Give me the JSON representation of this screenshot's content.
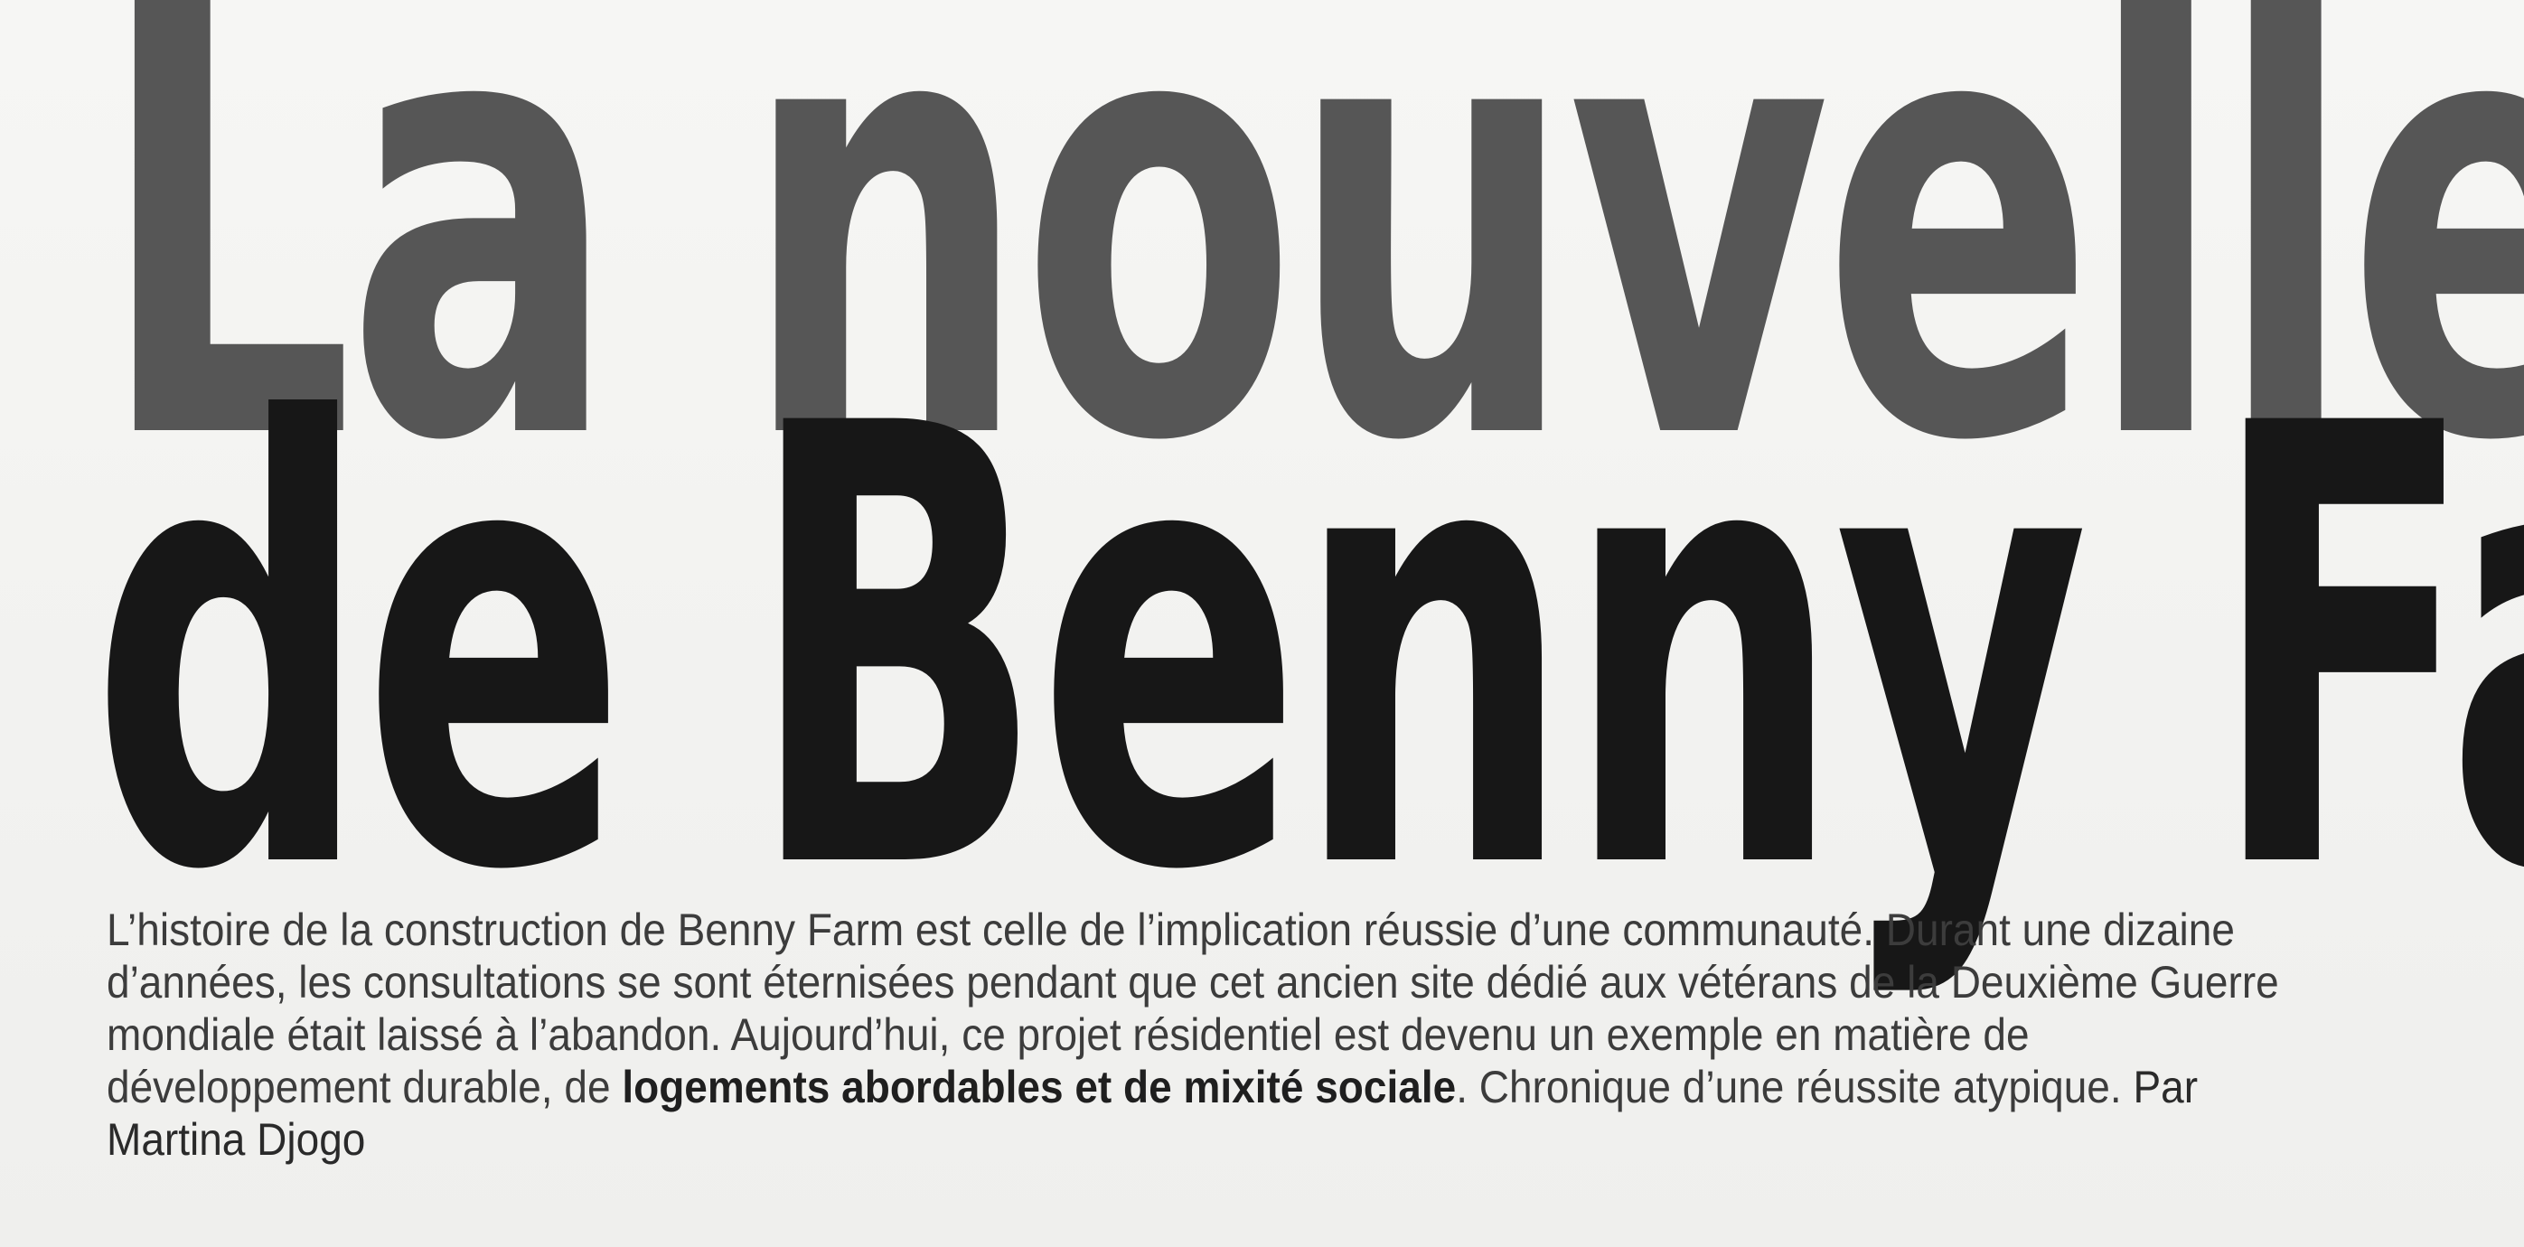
{
  "headline": {
    "line1": "La nouvelle vie",
    "line2": "de Benny Farm"
  },
  "intro": {
    "part1": "L’histoire de la construction de Benny Farm est celle de l’implication réussie d’une communauté. Durant une dizaine d’années, les consultations se sont éternisées pendant que cet ancien site dédié aux vétérans de la Deuxième Guerre mondiale était laissé à l’abandon. Aujourd’hui, ce projet résidentiel est devenu un exemple en matière de développement durable, de ",
    "emphasis": "logements abordables et de mixité sociale",
    "part2": ". Chronique d’une réussite atypique.",
    "byline": "Par Martina Djogo"
  }
}
